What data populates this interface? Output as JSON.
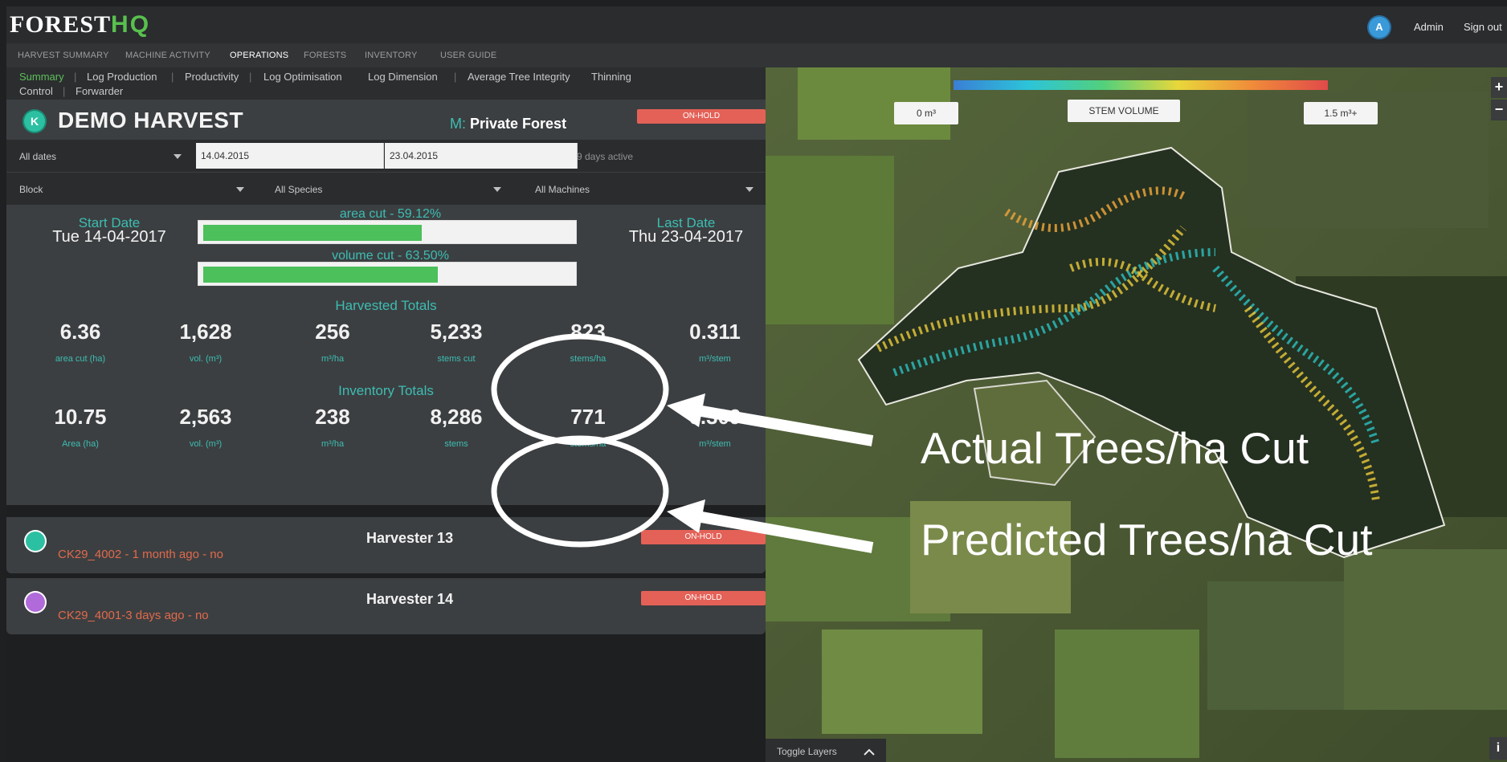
{
  "app": {
    "logo_main": "FOREST",
    "logo_accent": "HQ",
    "user_initial": "A",
    "user_name": "Admin",
    "signout_label": "Sign out"
  },
  "nav": {
    "items": [
      {
        "label": "HARVEST SUMMARY",
        "active": false
      },
      {
        "label": "MACHINE ACTIVITY",
        "active": false
      },
      {
        "label": "OPERATIONS",
        "active": true
      },
      {
        "label": "FORESTS",
        "active": false
      },
      {
        "label": "INVENTORY",
        "active": false
      },
      {
        "label": "USER GUIDE",
        "active": false
      }
    ]
  },
  "subnav": {
    "items": [
      "Summary",
      "Log Production",
      "Productivity",
      "Log Optimisation",
      "Log Dimension",
      "Average Tree Integrity",
      "Thinning",
      "Control",
      "Forwarder"
    ],
    "active": "Summary"
  },
  "site": {
    "icon_letter": "K",
    "title": "DEMO HARVEST",
    "manager_prefix": "M:",
    "manager": "Private Forest",
    "status": "ON-HOLD"
  },
  "filters": {
    "date_range": "All dates",
    "start_date_input": "14.04.2015",
    "end_date_input": "23.04.2015",
    "days_active": "9 days active",
    "block": "Block",
    "species": "All Species",
    "machines": "All Machines"
  },
  "progress": {
    "start_label": "Start Date",
    "start_value": "Tue 14-04-2017",
    "last_label": "Last Date",
    "last_value": "Thu 23-04-2017",
    "area_cut_label": "area cut - 59.12%",
    "area_cut_fraction": 0.5912,
    "volume_cut_label": "volume cut - 63.50%",
    "volume_cut_fraction": 0.635
  },
  "harvested": {
    "title": "Harvested Totals",
    "stats": [
      {
        "value": "6.36",
        "label": "area cut (ha)"
      },
      {
        "value": "1,628",
        "label": "vol. (m³)"
      },
      {
        "value": "256",
        "label": "m³/ha"
      },
      {
        "value": "5,233",
        "label": "stems cut"
      },
      {
        "value": "823",
        "label": "stems/ha"
      },
      {
        "value": "0.311",
        "label": "m³/stem"
      }
    ]
  },
  "inventory": {
    "title": "Inventory Totals",
    "stats": [
      {
        "value": "10.75",
        "label": "Area (ha)"
      },
      {
        "value": "2,563",
        "label": "vol. (m³)"
      },
      {
        "value": "238",
        "label": "m³/ha"
      },
      {
        "value": "8,286",
        "label": "stems"
      },
      {
        "value": "771",
        "label": "stems/ha"
      },
      {
        "value": "0.309",
        "label": "m³/stem"
      }
    ]
  },
  "machines": [
    {
      "name": "Harvester 13",
      "subtitle": "CK29_4002 - 1  month  ago - no",
      "status": "ON-HOLD",
      "icon_color": "#2cc0a2"
    },
    {
      "name": "Harvester 14",
      "subtitle": "CK29_4001-3 days ago - no",
      "status": "ON-HOLD",
      "icon_color": "#b06ad9"
    }
  ],
  "map": {
    "legend_min": "0 m³",
    "legend_title": "STEM VOLUME",
    "legend_max": "1.5 m³+",
    "zoom_in": "+",
    "zoom_out": "−",
    "toggle_layers": "Toggle Layers",
    "info": "i"
  },
  "annotations": {
    "actual": "Actual Trees/ha Cut",
    "predicted": "Predicted Trees/ha Cut"
  },
  "colors": {
    "accent_green": "#4cc05a",
    "teal": "#3cbdb3",
    "status_red": "#e46157"
  }
}
